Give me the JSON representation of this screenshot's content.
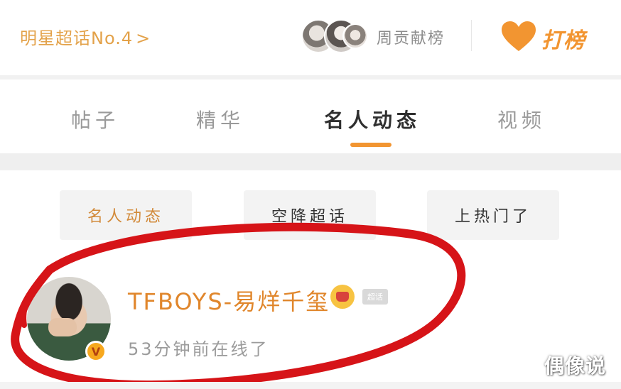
{
  "header": {
    "rank_link": "明星超话No.4",
    "rank_chevron": ">",
    "contrib_label": "周贡献榜",
    "dabang_label": "打榜"
  },
  "tabs": [
    {
      "label": "帖子",
      "active": false
    },
    {
      "label": "精华",
      "active": false
    },
    {
      "label": "名人动态",
      "active": true
    },
    {
      "label": "视频",
      "active": false
    }
  ],
  "chips": [
    {
      "label": "名人动态"
    },
    {
      "label": "空降超话"
    },
    {
      "label": "上热门了"
    }
  ],
  "post": {
    "username": "TFBOYS-易烊千玺",
    "level_badge": "超话",
    "verified_badge": "V",
    "status": "53分钟前在线了"
  },
  "watermark": "偶像说",
  "colors": {
    "accent": "#f29531",
    "username": "#e0862b",
    "annotation_circle": "#d61418"
  },
  "icons": {
    "heart": "heart-icon",
    "crown": "crown-icon",
    "verified": "verified-v-icon"
  }
}
